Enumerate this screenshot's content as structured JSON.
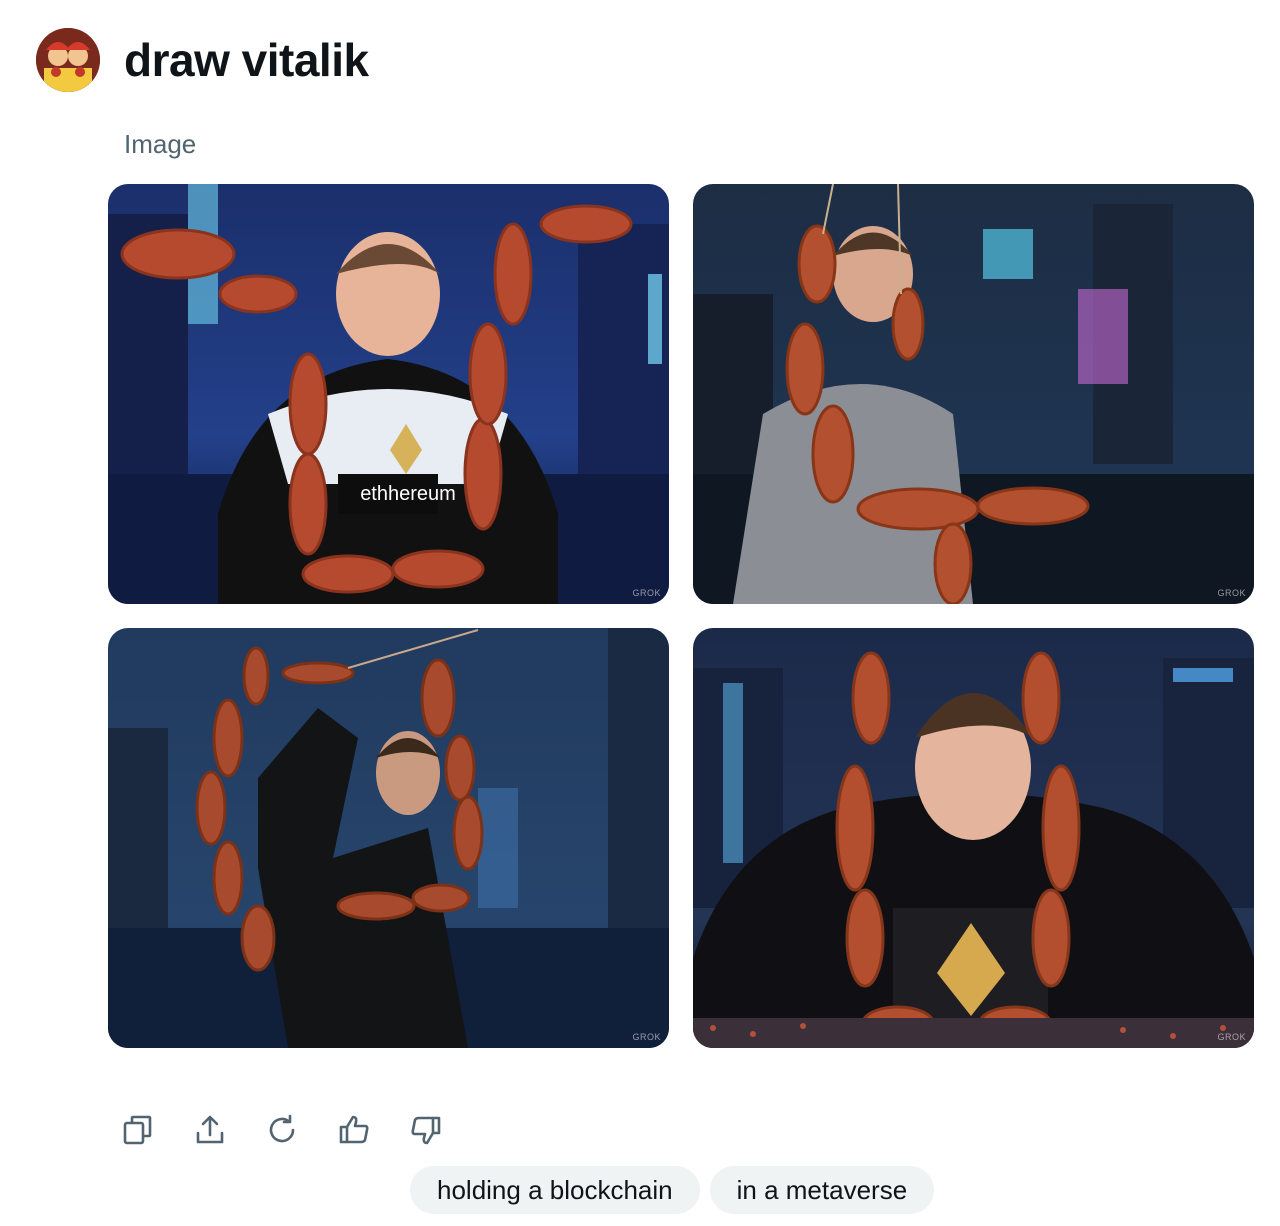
{
  "message": {
    "prompt": "draw vitalik",
    "avatar_icon": "user-avatar-icon"
  },
  "result": {
    "section_label": "Image",
    "images": [
      {
        "name": "generated-image-1",
        "watermark": "GROK"
      },
      {
        "name": "generated-image-2",
        "watermark": "GROK"
      },
      {
        "name": "generated-image-3",
        "watermark": "GROK"
      },
      {
        "name": "generated-image-4",
        "watermark": "GROK"
      }
    ],
    "image1_shirt_text": "ethhereum"
  },
  "actions": [
    {
      "icon": "copy-icon"
    },
    {
      "icon": "share-icon"
    },
    {
      "icon": "regenerate-icon"
    },
    {
      "icon": "thumbs-up-icon"
    },
    {
      "icon": "thumbs-down-icon"
    }
  ],
  "suggestions": {
    "chip1": "holding a blockchain",
    "chip2": "in a metaverse"
  },
  "colors": {
    "text_primary": "#0f1419",
    "text_secondary": "#536471",
    "chip_background": "#eff3f4"
  }
}
